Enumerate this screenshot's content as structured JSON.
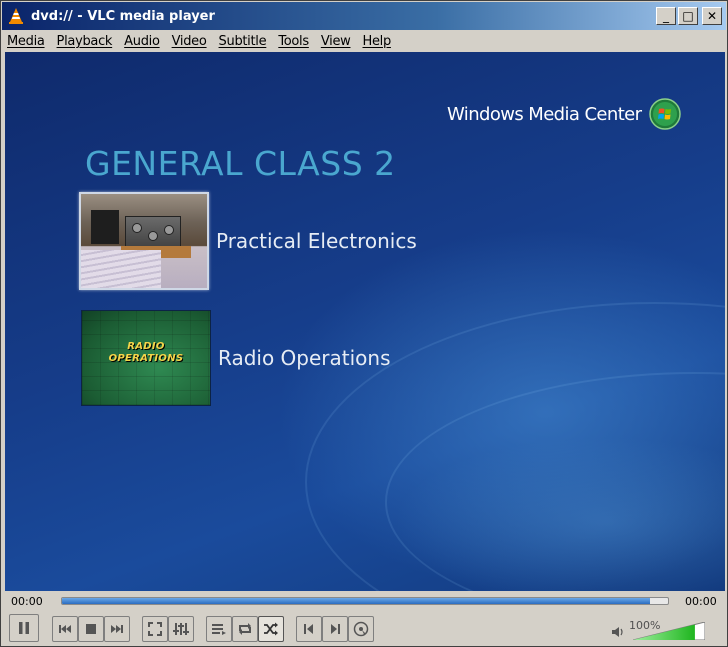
{
  "window": {
    "title": "dvd:// - VLC media player",
    "buttons": {
      "minimize": "_",
      "maximize": "□",
      "close": "✕"
    }
  },
  "menubar": {
    "items": [
      "Media",
      "Playback",
      "Audio",
      "Video",
      "Subtitle",
      "Tools",
      "View",
      "Help"
    ]
  },
  "video": {
    "brand": "Windows Media Center",
    "heading": "GENERAL CLASS 2",
    "options": [
      {
        "label": "Practical Electronics",
        "selected": true
      },
      {
        "label": "Radio Operations",
        "selected": false,
        "thumb_caption_line1": "RADIO",
        "thumb_caption_line2": "OPERATIONS"
      }
    ]
  },
  "playback": {
    "elapsed": "00:00",
    "total": "00:00",
    "progress_fraction": 0.97
  },
  "controls": {
    "buttons": [
      "pause-icon",
      "previous-icon",
      "stop-icon",
      "next-icon",
      "fullscreen-icon",
      "extended-settings-icon",
      "playlist-icon",
      "loop-icon",
      "random-icon",
      "previous-frame-icon",
      "next-frame-icon",
      "dvd-menu-icon"
    ],
    "random_pressed": true
  },
  "volume": {
    "label": "100%",
    "level_fraction": 0.86
  },
  "colors": {
    "heading": "#4aa7cf",
    "title_bar_start": "#0a246a",
    "seek_fill": "#2a6cc0",
    "volume_fill": "#3cc83c"
  }
}
